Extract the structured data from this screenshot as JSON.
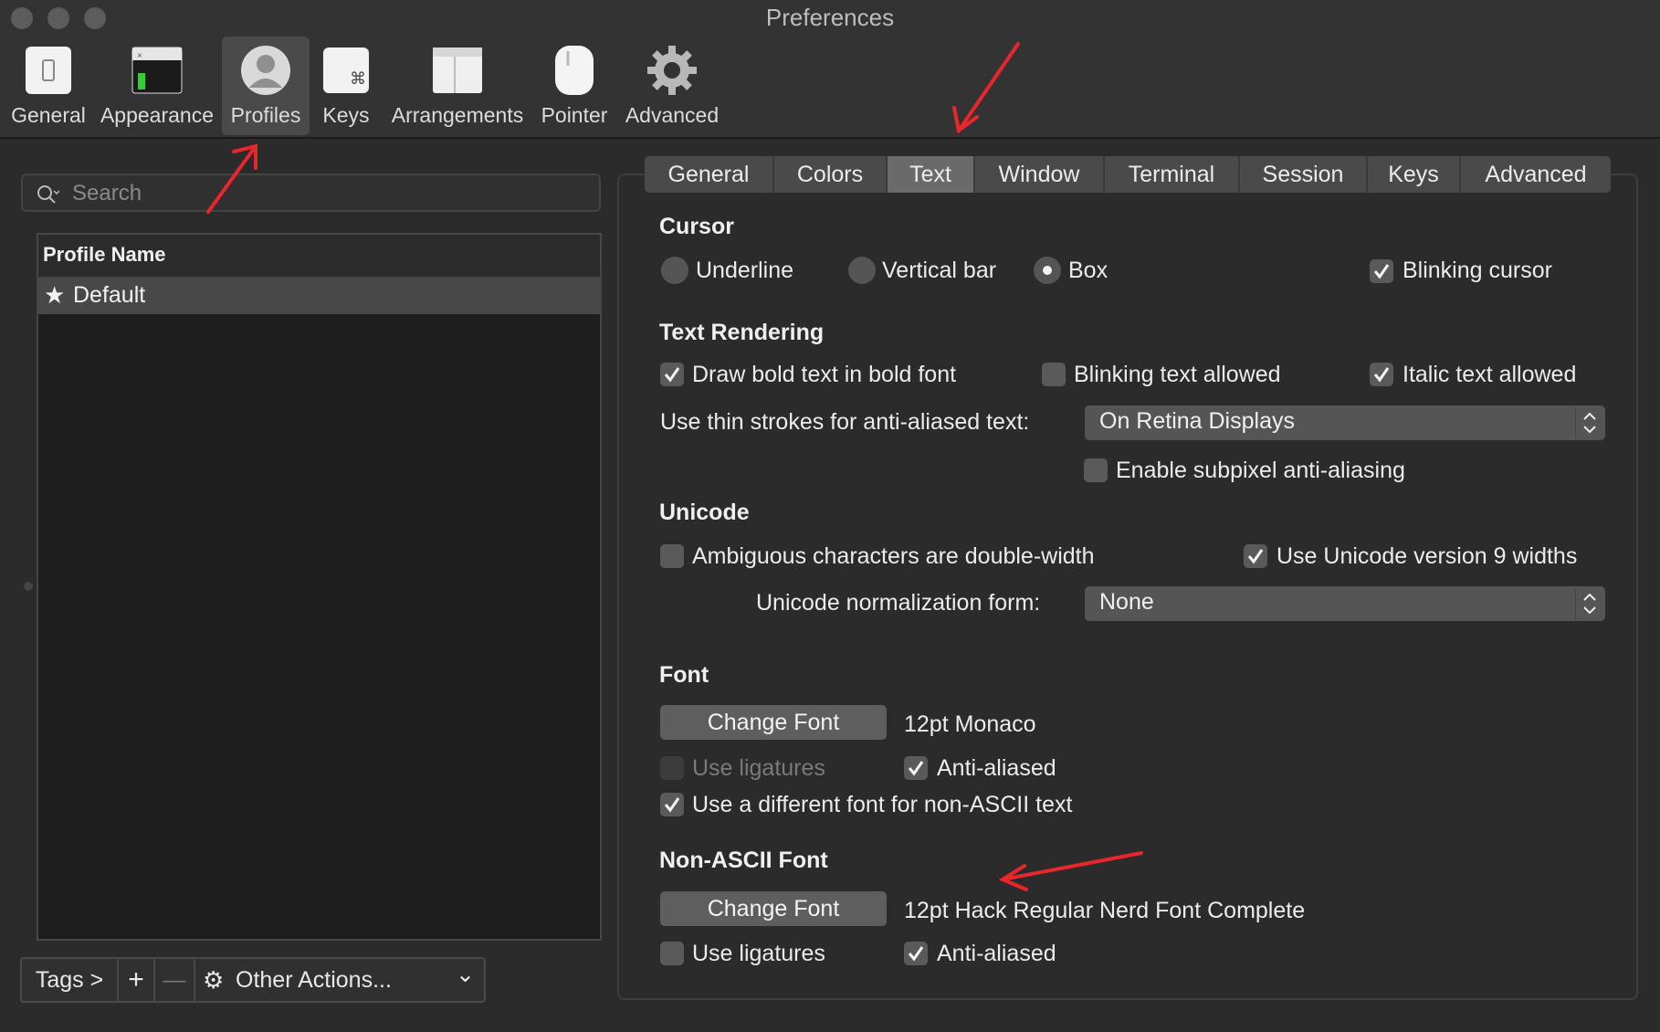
{
  "window": {
    "title": "Preferences"
  },
  "toolbar": [
    {
      "label": "General",
      "icon": "general-icon"
    },
    {
      "label": "Appearance",
      "icon": "appearance-icon"
    },
    {
      "label": "Profiles",
      "icon": "profiles-icon",
      "active": true
    },
    {
      "label": "Keys",
      "icon": "keys-icon"
    },
    {
      "label": "Arrangements",
      "icon": "arrangements-icon"
    },
    {
      "label": "Pointer",
      "icon": "pointer-icon"
    },
    {
      "label": "Advanced",
      "icon": "advanced-gear-icon"
    }
  ],
  "sidebar": {
    "search_placeholder": "Search",
    "column_header": "Profile Name",
    "profiles": [
      {
        "name": "Default",
        "star": "★"
      }
    ],
    "bottom": {
      "tags": "Tags >",
      "add": "+",
      "remove": "—",
      "other_actions": "Other Actions...",
      "gear": "⚙",
      "chevron": "⌄"
    }
  },
  "tabs": [
    "General",
    "Colors",
    "Text",
    "Window",
    "Terminal",
    "Session",
    "Keys",
    "Advanced"
  ],
  "active_tab": "Text",
  "cursor": {
    "title": "Cursor",
    "options": [
      {
        "label": "Underline",
        "checked": false
      },
      {
        "label": "Vertical bar",
        "checked": false
      },
      {
        "label": "Box",
        "checked": true
      }
    ],
    "blinking": {
      "label": "Blinking cursor",
      "checked": true
    }
  },
  "text_rendering": {
    "title": "Text Rendering",
    "draw_bold": {
      "label": "Draw bold text in bold font",
      "checked": true
    },
    "blinking_text": {
      "label": "Blinking text allowed",
      "checked": false
    },
    "italic": {
      "label": "Italic text allowed",
      "checked": true
    },
    "thin_strokes_label": "Use thin strokes for anti-aliased text:",
    "thin_strokes_value": "On Retina Displays",
    "subpixel": {
      "label": "Enable subpixel anti-aliasing",
      "checked": false
    }
  },
  "unicode": {
    "title": "Unicode",
    "ambiguous": {
      "label": "Ambiguous characters are double-width",
      "checked": false
    },
    "v9": {
      "label": "Use Unicode version 9 widths",
      "checked": true
    },
    "normalization_label": "Unicode normalization form:",
    "normalization_value": "None"
  },
  "font": {
    "title": "Font",
    "change_button": "Change Font",
    "current": "12pt Monaco",
    "ligatures": {
      "label": "Use ligatures",
      "checked": false,
      "disabled": true
    },
    "anti_aliased": {
      "label": "Anti-aliased",
      "checked": true
    },
    "different_font": {
      "label": "Use a different font for non-ASCII text",
      "checked": true
    }
  },
  "non_ascii_font": {
    "title": "Non-ASCII Font",
    "change_button": "Change Font",
    "current": "12pt Hack Regular Nerd Font Complete",
    "ligatures": {
      "label": "Use ligatures",
      "checked": false
    },
    "anti_aliased": {
      "label": "Anti-aliased",
      "checked": true
    }
  },
  "colors": {
    "annotation": "#e8262b",
    "active_bg": "#4a4a4a"
  }
}
